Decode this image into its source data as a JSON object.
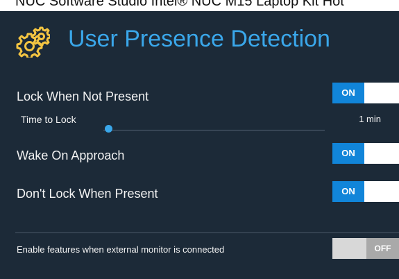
{
  "window": {
    "title": "NUC Software Studio Intel® NUC M15 Laptop Kit Hot"
  },
  "header": {
    "icon": "gear-icon",
    "title": "User Presence Detection"
  },
  "settings": {
    "lock_when_not_present": {
      "label": "Lock When Not Present",
      "toggle_state": "ON",
      "time_to_lock_label": "Time to Lock",
      "time_to_lock_value": "1 min",
      "slider_level": 0.02
    },
    "wake_on_approach": {
      "label": "Wake On Approach",
      "toggle_state": "ON"
    },
    "dont_lock_when_present": {
      "label": "Don't Lock When Present",
      "toggle_state": "ON"
    },
    "external_monitor": {
      "label": "Enable features when external monitor is connected",
      "toggle_state": "OFF"
    }
  },
  "colors": {
    "background": "#1c2a38",
    "accent": "#3aa7ea",
    "toggle_on": "#1185d9",
    "toggle_off": "#a9a9a9"
  }
}
